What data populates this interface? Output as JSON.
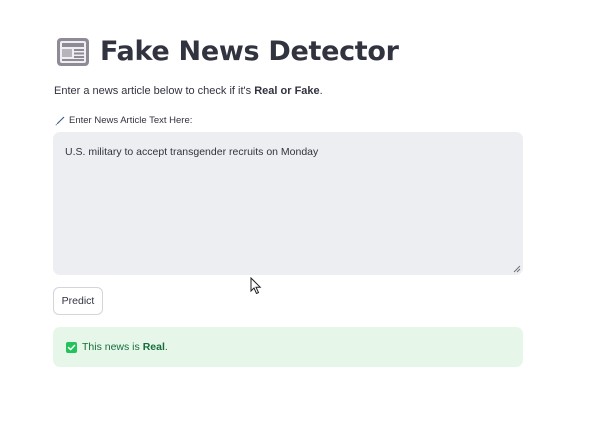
{
  "header": {
    "title": "Fake News Detector",
    "icon": "newspaper-icon"
  },
  "intro": {
    "prefix": "Enter a news article below to check if it's ",
    "real": "Real",
    "or": " or ",
    "fake": "Fake",
    "suffix": "."
  },
  "input": {
    "label": "Enter News Article Text Here:",
    "label_icon": "pencil-icon",
    "value": "U.S. military to accept transgender recruits on Monday"
  },
  "actions": {
    "predict_label": "Predict"
  },
  "result": {
    "icon": "check-box-icon",
    "prefix": "This news is ",
    "verdict": "Real",
    "suffix": ".",
    "background": "#e6f7ea",
    "text_color": "#176c3a"
  },
  "colors": {
    "text": "#31333f",
    "input_bg": "#eceef2",
    "success_bg": "#e6f7ea",
    "success_green": "#21c35a"
  }
}
